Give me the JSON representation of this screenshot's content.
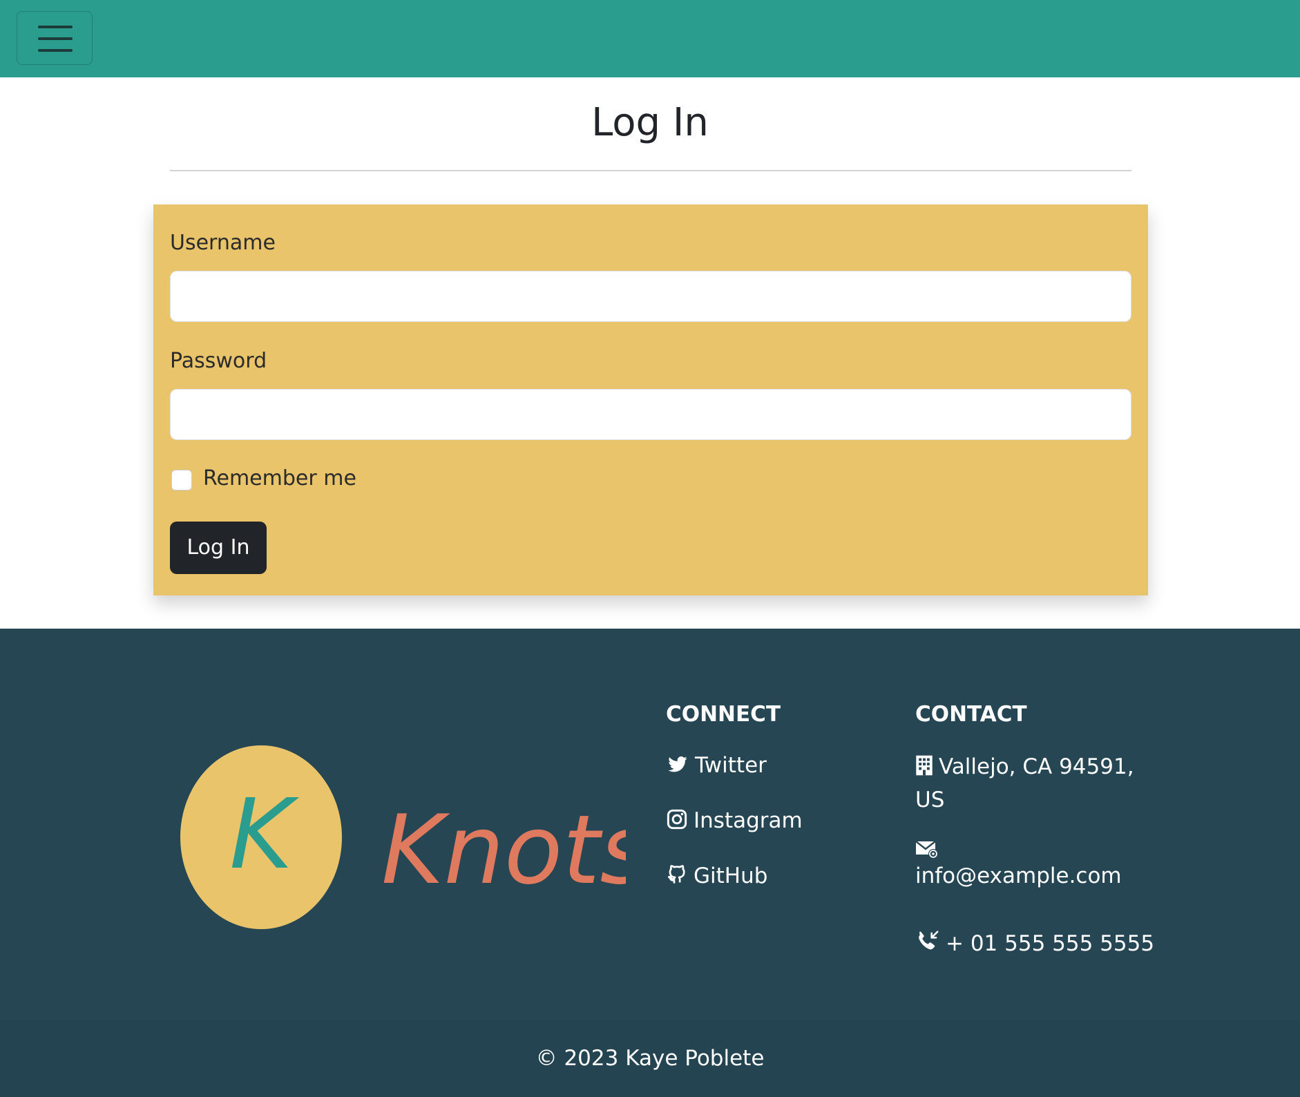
{
  "navbar": {
    "toggle_icon": "hamburger-menu-icon",
    "background_color": "#2a9d8f"
  },
  "main": {
    "title": "Log In"
  },
  "login_form": {
    "background_color": "#e9c46a",
    "username_label": "Username",
    "username_value": "",
    "password_label": "Password",
    "password_value": "",
    "remember_label": "Remember me",
    "remember_checked": false,
    "submit_label": "Log In"
  },
  "footer": {
    "background_color": "#264653",
    "logo": {
      "letter": "K",
      "wordmark": "Knots"
    },
    "connect": {
      "heading": "CONNECT",
      "links": [
        {
          "label": "Twitter",
          "icon": "twitter-icon"
        },
        {
          "label": "Instagram",
          "icon": "instagram-icon"
        },
        {
          "label": "GitHub",
          "icon": "github-icon"
        }
      ]
    },
    "contact": {
      "heading": "CONTACT",
      "address_line1": "Vallejo, CA 94591,",
      "address_line2": "US",
      "address_icon": "building-icon",
      "email": "info@example.com",
      "email_icon": "envelope-at-icon",
      "phone": "+ 01 555 555 5555",
      "phone_icon": "telephone-inbound-icon"
    },
    "copyright": "© 2023 Kaye Poblete"
  }
}
